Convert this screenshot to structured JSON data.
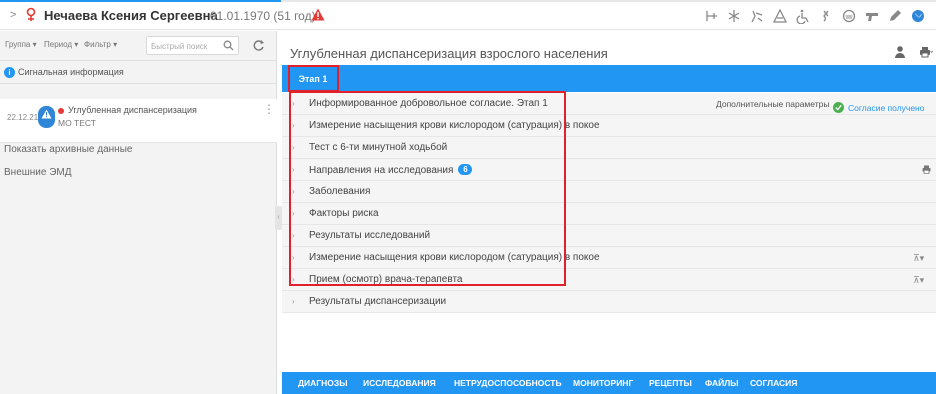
{
  "progress": {
    "value_percent": 30,
    "color": "#2196f3"
  },
  "patient": {
    "name": "Нечаева Ксения Сергеевна",
    "dob": "01.01.1970 (51 год)",
    "gender_icon": "female-icon",
    "warning_icon": "warning-icon"
  },
  "toolbar_icons": [
    "medical-cross-icon",
    "snowflake-icon",
    "dropper-icon",
    "triangle-icon",
    "wheelchair-icon",
    "link-icon",
    "face-mask-icon",
    "gun-icon",
    "pencil-icon",
    "globe-icon"
  ],
  "left": {
    "filters": [
      "Группа ▾",
      "Период ▾",
      "Фильтр ▾"
    ],
    "search_placeholder": "Быстрый поиск",
    "signal_info": "Сигнальная информация",
    "event": {
      "date": "22.12.21",
      "title": "Углубленная диспансеризация",
      "subtitle": "МО ТЕСТ"
    },
    "show_archive": "Показать архивные данные",
    "external_emd": "Внешние ЭМД"
  },
  "main": {
    "title": "Углубленная диспансеризация взрослого населения",
    "stage_tab": "Этап 1",
    "extra_params": "Дополнительные параметры",
    "consent_status": "Согласие получено",
    "sections": [
      {
        "label": "Информированное добровольное согласие. Этап 1"
      },
      {
        "label": "Измерение насыщения крови кислородом (сатурация) в покое"
      },
      {
        "label": "Тест с 6-ти минутной ходьбой"
      },
      {
        "label": "Направления на исследования",
        "count": "6"
      },
      {
        "label": "Заболевания"
      },
      {
        "label": "Факторы риска"
      },
      {
        "label": "Результаты исследований"
      },
      {
        "label": "Измерение насыщения крови кислородом (сатурация) в покое"
      },
      {
        "label": "Прием (осмотр) врача-терапевта"
      },
      {
        "label": "Результаты диспансеризации"
      }
    ]
  },
  "bottom_tabs": [
    "ДИАГНОЗЫ",
    "ИССЛЕДОВАНИЯ",
    "НЕТРУДОСПОСОБНОСТЬ",
    "МОНИТОРИНГ",
    "РЕЦЕПТЫ",
    "ФАЙЛЫ",
    "СОГЛАСИЯ"
  ],
  "colors": {
    "accent": "#2196f3",
    "highlight": "#e0202a",
    "warning": "#e53935",
    "ok": "#4caf50"
  }
}
